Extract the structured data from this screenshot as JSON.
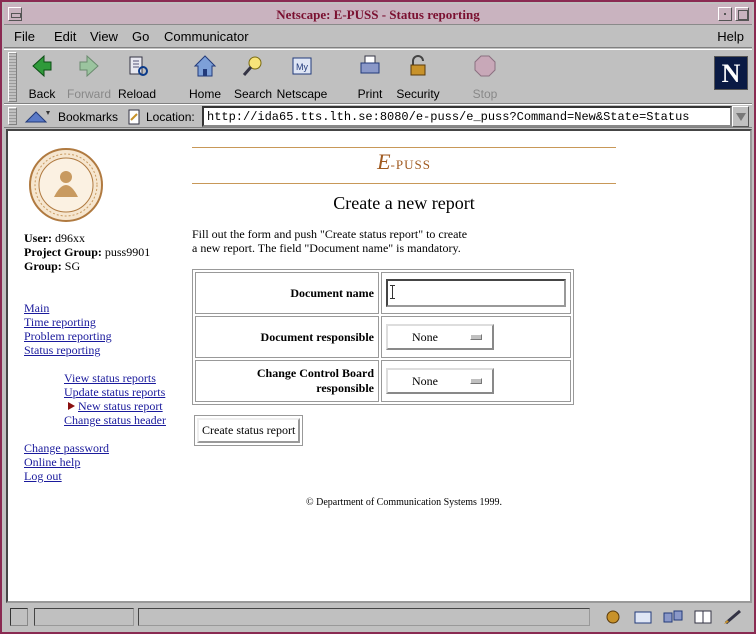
{
  "window": {
    "title": "Netscape: E-PUSS - Status reporting"
  },
  "menu": {
    "items": [
      "File",
      "Edit",
      "View",
      "Go",
      "Communicator"
    ],
    "help": "Help"
  },
  "toolbar": {
    "buttons": [
      {
        "label": "Back",
        "icon": "back-arrow-icon",
        "enabled": true
      },
      {
        "label": "Forward",
        "icon": "forward-arrow-icon",
        "enabled": false
      },
      {
        "label": "Reload",
        "icon": "reload-icon",
        "enabled": true
      },
      {
        "label": "Home",
        "icon": "home-icon",
        "enabled": true
      },
      {
        "label": "Search",
        "icon": "search-icon",
        "enabled": true
      },
      {
        "label": "Netscape",
        "icon": "netscape-icon",
        "enabled": true
      },
      {
        "label": "Print",
        "icon": "print-icon",
        "enabled": true
      },
      {
        "label": "Security",
        "icon": "security-lock-icon",
        "enabled": true
      },
      {
        "label": "Stop",
        "icon": "stop-icon",
        "enabled": false
      }
    ],
    "logo_letter": "N"
  },
  "location": {
    "bookmarks_label": "Bookmarks",
    "location_label": "Location:",
    "url": "http://ida65.tts.lth.se:8080/e-puss/e_puss?Command=New&State=Status"
  },
  "sidebar": {
    "user_label": "User:",
    "user": "d96xx",
    "project_label": "Project Group:",
    "project": "puss9901",
    "group_label": "Group:",
    "group": "SG",
    "nav": [
      "Main",
      "Time reporting",
      "Problem reporting",
      "Status reporting"
    ],
    "sub": [
      "View status reports",
      "Update status reports",
      "New status report",
      "Change status header"
    ],
    "account": [
      "Change password",
      "Online help",
      "Log out"
    ]
  },
  "main": {
    "brand_e": "E",
    "brand_rest": "-PUSS",
    "title": "Create a new report",
    "intro_line1": "Fill out the form and push \"Create status report\" to create",
    "intro_line2": "a new report. The field \"Document name\" is mandatory.",
    "form": {
      "doc_name_label": "Document name",
      "doc_name_value": "",
      "doc_resp_label": "Document responsible",
      "doc_resp_value": "None",
      "ccb_label": "Change Control Board responsible",
      "ccb_value": "None",
      "submit_label": "Create status report"
    },
    "footer": "© Department of Communication Systems 1999."
  },
  "colors": {
    "title_bg": "#c9b3bf",
    "link": "#1a1a9c",
    "brand": "#a05a20",
    "window_border": "#8a2a52"
  }
}
